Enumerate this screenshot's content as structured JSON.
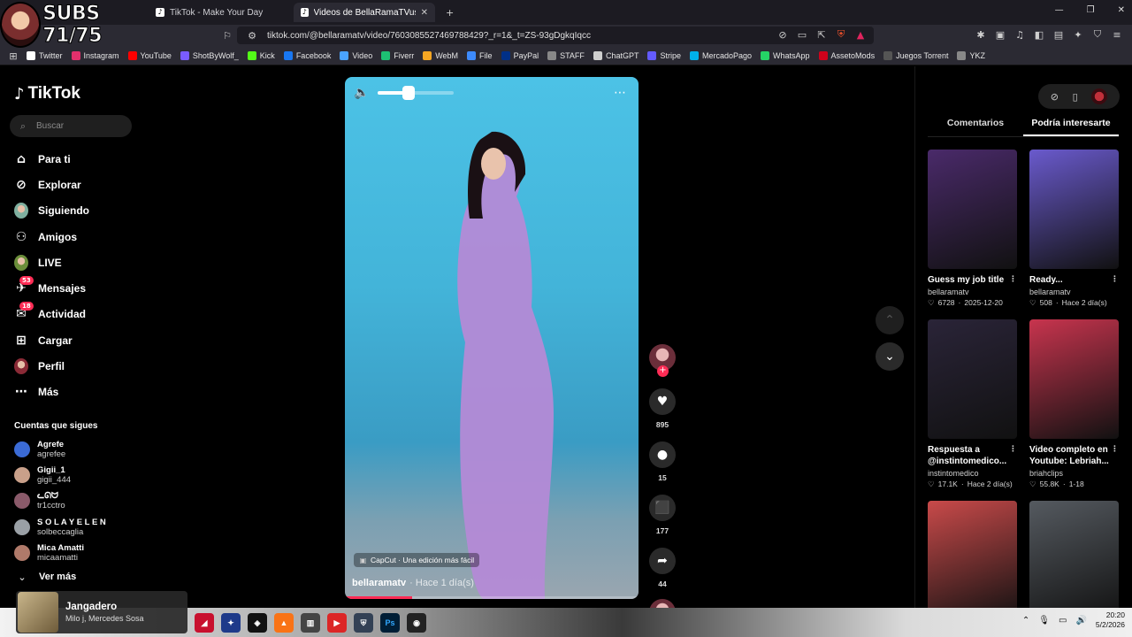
{
  "overlay": {
    "subs_text": "SUBS 71/75"
  },
  "browser": {
    "tabs": [
      {
        "title": "TikTok - Make Your Day",
        "active": false
      },
      {
        "title": "Videos de BellaRamaTVus (@",
        "active": true
      }
    ],
    "url": "tiktok.com/@bellaramatv/video/7603085527469788429?_r=1&_t=ZS-93gDgkqIqcc",
    "bookmarks": [
      {
        "label": "Twitter",
        "color": "#ffffff"
      },
      {
        "label": "Instagram",
        "color": "#e1306c"
      },
      {
        "label": "YouTube",
        "color": "#ff0000"
      },
      {
        "label": "ShotByWolf_",
        "color": "#7a5cff"
      },
      {
        "label": "Kick",
        "color": "#53fc18"
      },
      {
        "label": "Facebook",
        "color": "#1877f2"
      },
      {
        "label": "Video",
        "color": "#4aa3ff"
      },
      {
        "label": "Fiverr",
        "color": "#1dbf73"
      },
      {
        "label": "WebM",
        "color": "#f5a623"
      },
      {
        "label": "File",
        "color": "#3d8bfd"
      },
      {
        "label": "PayPal",
        "color": "#003087"
      },
      {
        "label": "STAFF",
        "color": "#888888"
      },
      {
        "label": "ChatGPT",
        "color": "#cfcfcf"
      },
      {
        "label": "Stripe",
        "color": "#635bff"
      },
      {
        "label": "MercadoPago",
        "color": "#00b1ea"
      },
      {
        "label": "WhatsApp",
        "color": "#25d366"
      },
      {
        "label": "AssetoMods",
        "color": "#d0021b"
      },
      {
        "label": "Juegos Torrent",
        "color": "#555555"
      },
      {
        "label": "YKZ",
        "color": "#888888"
      }
    ]
  },
  "tiktok": {
    "logo": "TikTok",
    "search_placeholder": "Buscar",
    "nav": [
      {
        "label": "Para ti",
        "icon": "home-icon"
      },
      {
        "label": "Explorar",
        "icon": "compass-icon"
      },
      {
        "label": "Siguiendo",
        "icon": "following-avatar"
      },
      {
        "label": "Amigos",
        "icon": "friends-icon"
      },
      {
        "label": "LIVE",
        "icon": "live-avatar"
      },
      {
        "label": "Mensajes",
        "icon": "messages-icon",
        "badge": "53"
      },
      {
        "label": "Actividad",
        "icon": "activity-icon",
        "badge": "18"
      },
      {
        "label": "Cargar",
        "icon": "upload-icon"
      },
      {
        "label": "Perfil",
        "icon": "profile-avatar"
      },
      {
        "label": "Más",
        "icon": "more-icon"
      }
    ],
    "following_title": "Cuentas que sigues",
    "following": [
      {
        "name": "Agrefe",
        "handle": "agrefee"
      },
      {
        "name": "Gigii_1",
        "handle": "gigii_444"
      },
      {
        "name": "ᓚᘏᗢ",
        "handle": "tr1cctro"
      },
      {
        "name": "S O L A Y E L E N",
        "handle": "solbeccaglia"
      },
      {
        "name": "Mica Amatti",
        "handle": "micaamatti"
      }
    ],
    "see_more": "Ver más",
    "video": {
      "volume_fraction": 0.4,
      "progress_fraction": 0.23,
      "capcut": "CapCut · Una edición más fácil",
      "author": "bellaramatv",
      "time": "· Hace 1 día(s)"
    },
    "actions": {
      "likes": "895",
      "comments": "15",
      "saves": "177",
      "shares": "44"
    },
    "right_panel": {
      "tabs": [
        "Comentarios",
        "Podría interesarte"
      ],
      "cards": [
        {
          "title": "Guess my job title",
          "author": "bellaramatv",
          "likes": "6728",
          "date": "2025-12-20",
          "thumb": "#4a2a6a"
        },
        {
          "title": "Ready...",
          "author": "bellaramatv",
          "likes": "508",
          "date": "Hace 2 día(s)",
          "thumb": "#6a5acd"
        },
        {
          "title": "Respuesta a @instintomedico...",
          "author": "instintomedico",
          "likes": "17.1K",
          "date": "Hace 2 día(s)",
          "thumb": "#2a2438"
        },
        {
          "title": "Video completo en Youtube: Lebriah...",
          "author": "briahclips",
          "likes": "55.8K",
          "date": "1-18",
          "thumb": "#c8344e"
        },
        {
          "title": "",
          "author": "",
          "likes": "",
          "date": "",
          "thumb": "#c94a4a"
        },
        {
          "title": "",
          "author": "",
          "likes": "",
          "date": "",
          "thumb": "#555a60"
        }
      ]
    }
  },
  "taskbar": {
    "now_playing_title": "Jangadero",
    "now_playing_artist": "Milo j, Mercedes Sosa",
    "time": "20:20",
    "date": "5/2/2026"
  }
}
